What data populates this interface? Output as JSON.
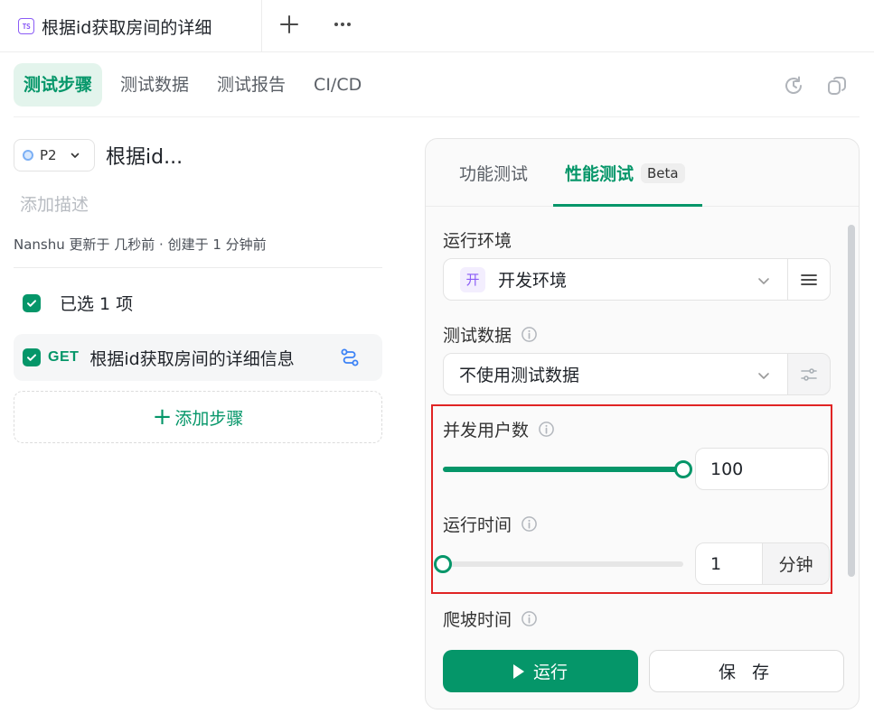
{
  "file_tab": {
    "icon_text": "TS",
    "title": "根据id获取房间的详细"
  },
  "subnav": {
    "items": [
      {
        "label": "测试步骤",
        "active": true
      },
      {
        "label": "测试数据",
        "active": false
      },
      {
        "label": "测试报告",
        "active": false
      },
      {
        "label": "CI/CD",
        "active": false
      }
    ]
  },
  "case": {
    "priority": "P2",
    "title": "根据id...",
    "description_placeholder": "添加描述",
    "meta": "Nanshu 更新于 几秒前 · 创建于 1 分钟前"
  },
  "steps": {
    "selected_label": "已选 1 项",
    "items": [
      {
        "method": "GET",
        "name": "根据id获取房间的详细信息",
        "checked": true
      }
    ],
    "add_label": "添加步骤"
  },
  "perf_panel": {
    "tabs": [
      {
        "label": "功能测试",
        "active": false
      },
      {
        "label": "性能测试",
        "active": true,
        "badge": "Beta"
      }
    ],
    "env_label": "运行环境",
    "env_badge": "开",
    "env_value": "开发环境",
    "data_label": "测试数据",
    "data_value": "不使用测试数据",
    "users_label": "并发用户数",
    "users_value": "100",
    "users_slider_fraction": 1.0,
    "duration_label": "运行时间",
    "duration_value": "1",
    "duration_unit": "分钟",
    "duration_slider_fraction": 0.0,
    "ramp_label": "爬坡时间",
    "run_label": "运行",
    "save_label": "保 存"
  },
  "colors": {
    "accent": "#059669",
    "highlight": "#e02424"
  }
}
